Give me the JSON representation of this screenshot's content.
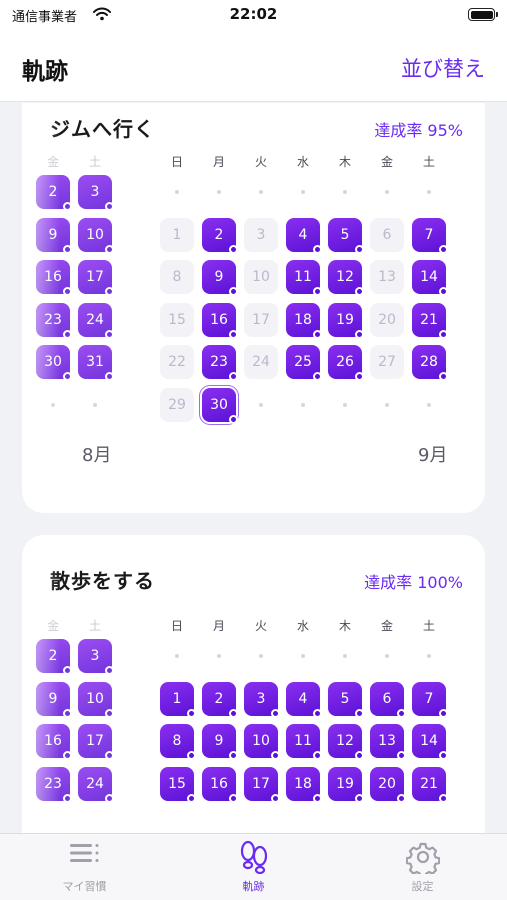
{
  "status_bar": {
    "carrier": "通信事業者",
    "time": "22:02"
  },
  "nav": {
    "title": "軌跡",
    "action_label": "並び替え"
  },
  "colors": {
    "accent": "#6a2cf0",
    "done": "#5b12d6",
    "missed": "#f3f3f7"
  },
  "habits": [
    {
      "title": "ジムへ行く",
      "rate": "達成率 95%",
      "prev_month": {
        "label": "8月",
        "weekdays": [
          "金",
          "土"
        ],
        "days": [
          {
            "day": "2",
            "done": true
          },
          {
            "day": "3",
            "done": true
          },
          {
            "day": "9",
            "done": true
          },
          {
            "day": "10",
            "done": true
          },
          {
            "day": "16",
            "done": true
          },
          {
            "day": "17",
            "done": true
          },
          {
            "day": "23",
            "done": true
          },
          {
            "day": "24",
            "done": true
          },
          {
            "day": "30",
            "done": true
          },
          {
            "day": "31",
            "done": true
          }
        ]
      },
      "month": {
        "label": "9月",
        "weekdays": [
          "日",
          "月",
          "火",
          "水",
          "木",
          "金",
          "土"
        ],
        "days": [
          {
            "day": "1",
            "done": false
          },
          {
            "day": "2",
            "done": true
          },
          {
            "day": "3",
            "done": false
          },
          {
            "day": "4",
            "done": true
          },
          {
            "day": "5",
            "done": true
          },
          {
            "day": "6",
            "done": false
          },
          {
            "day": "7",
            "done": true
          },
          {
            "day": "8",
            "done": false
          },
          {
            "day": "9",
            "done": true
          },
          {
            "day": "10",
            "done": false
          },
          {
            "day": "11",
            "done": true
          },
          {
            "day": "12",
            "done": true
          },
          {
            "day": "13",
            "done": false
          },
          {
            "day": "14",
            "done": true
          },
          {
            "day": "15",
            "done": false
          },
          {
            "day": "16",
            "done": true
          },
          {
            "day": "17",
            "done": false
          },
          {
            "day": "18",
            "done": true
          },
          {
            "day": "19",
            "done": true
          },
          {
            "day": "20",
            "done": false
          },
          {
            "day": "21",
            "done": true
          },
          {
            "day": "22",
            "done": false
          },
          {
            "day": "23",
            "done": true
          },
          {
            "day": "24",
            "done": false
          },
          {
            "day": "25",
            "done": true
          },
          {
            "day": "26",
            "done": true
          },
          {
            "day": "27",
            "done": false
          },
          {
            "day": "28",
            "done": true
          },
          {
            "day": "29",
            "done": false
          },
          {
            "day": "30",
            "done": true,
            "today": true
          }
        ]
      }
    },
    {
      "title": "散歩をする",
      "rate": "達成率 100%",
      "prev_month": {
        "label": "",
        "weekdays": [
          "金",
          "土"
        ],
        "days": [
          {
            "day": "2",
            "done": true
          },
          {
            "day": "3",
            "done": true
          },
          {
            "day": "9",
            "done": true
          },
          {
            "day": "10",
            "done": true
          },
          {
            "day": "16",
            "done": true
          },
          {
            "day": "17",
            "done": true
          },
          {
            "day": "23",
            "done": true
          },
          {
            "day": "24",
            "done": true
          }
        ]
      },
      "month": {
        "label": "",
        "weekdays": [
          "日",
          "月",
          "火",
          "水",
          "木",
          "金",
          "土"
        ],
        "days": [
          {
            "day": "1",
            "done": true
          },
          {
            "day": "2",
            "done": true
          },
          {
            "day": "3",
            "done": true
          },
          {
            "day": "4",
            "done": true
          },
          {
            "day": "5",
            "done": true
          },
          {
            "day": "6",
            "done": true
          },
          {
            "day": "7",
            "done": true
          },
          {
            "day": "8",
            "done": true
          },
          {
            "day": "9",
            "done": true
          },
          {
            "day": "10",
            "done": true
          },
          {
            "day": "11",
            "done": true
          },
          {
            "day": "12",
            "done": true
          },
          {
            "day": "13",
            "done": true
          },
          {
            "day": "14",
            "done": true
          },
          {
            "day": "15",
            "done": true
          },
          {
            "day": "16",
            "done": true
          },
          {
            "day": "17",
            "done": true
          },
          {
            "day": "18",
            "done": true
          },
          {
            "day": "19",
            "done": true
          },
          {
            "day": "20",
            "done": true
          },
          {
            "day": "21",
            "done": true
          }
        ]
      }
    }
  ],
  "tabs": [
    {
      "label": "マイ習慣",
      "icon": "list-icon",
      "active": false
    },
    {
      "label": "軌跡",
      "icon": "footprints-icon",
      "active": true
    },
    {
      "label": "設定",
      "icon": "gear-icon",
      "active": false
    }
  ]
}
